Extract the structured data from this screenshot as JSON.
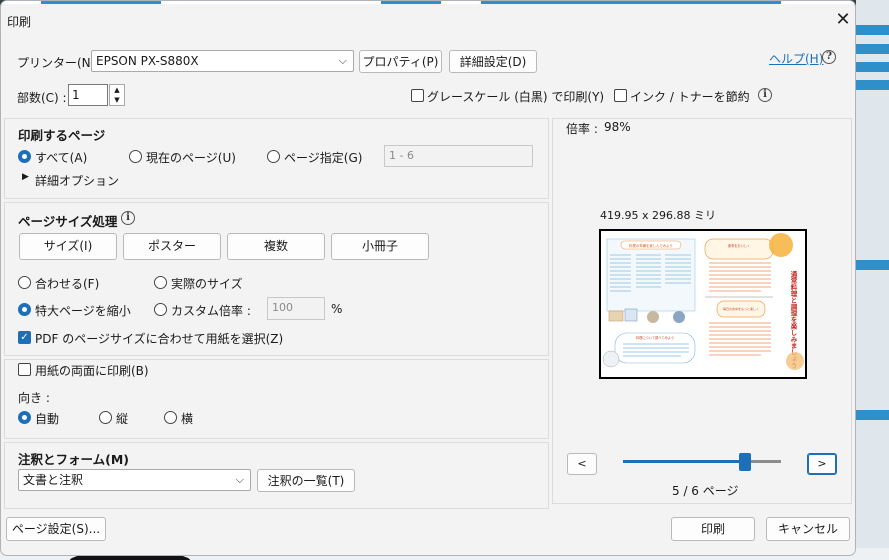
{
  "title": "印刷",
  "printer": {
    "label": "プリンター(N) :",
    "selected": "EPSON PX-S880X",
    "properties_button": "プロパティ(P)",
    "advanced_button": "詳細設定(D)",
    "help_link": "ヘルプ(H)"
  },
  "copies": {
    "label": "部数(C) :",
    "value": "1"
  },
  "options": {
    "grayscale": "グレースケール (白黒) で印刷(Y)",
    "save_ink": "インク / トナーを節約"
  },
  "pages_to_print": {
    "heading": "印刷するページ",
    "all": "すべて(A)",
    "current": "現在のページ(U)",
    "range": "ページ指定(G)",
    "range_placeholder": "1 - 6",
    "more_options": "詳細オプション"
  },
  "page_sizing": {
    "heading": "ページサイズ処理",
    "tabs": [
      "サイズ(I)",
      "ポスター",
      "複数",
      "小冊子"
    ],
    "fit": "合わせる(F)",
    "actual_size": "実際のサイズ",
    "shrink_oversized": "特大ページを縮小",
    "custom_scale": "カスタム倍率 :",
    "custom_scale_value": "100",
    "percent": "%",
    "choose_paper_by_pdf": "PDF のページサイズに合わせて用紙を選択(Z)"
  },
  "duplex": {
    "label": "用紙の両面に印刷(B)"
  },
  "orientation": {
    "label": "向き :",
    "auto": "自動",
    "portrait": "縦",
    "landscape": "横"
  },
  "comments_forms": {
    "heading": "注釈とフォーム(M)",
    "selected": "文書と注釈",
    "summarize_button": "注釈の一覧(T)"
  },
  "preview": {
    "scale_label": "倍率 :",
    "scale_value": "98%",
    "size_text": "419.95 x 296.88 ミリ",
    "page_indicator": "5 / 6 ページ",
    "prev": "<",
    "next": ">",
    "page_current": 5,
    "page_total": 6,
    "preview_texts": {
      "vertical_title": "通常料理と調理を楽しみましょう",
      "box1": "料理の準備を楽しんでみよう",
      "box2": "料理について調べてみよう",
      "box3": "食事をおいしく",
      "box4": "毎日の食卓をもっと楽しく"
    }
  },
  "footer": {
    "page_setup": "ページ設定(S)...",
    "print": "印刷",
    "cancel": "キャンセル"
  },
  "colors": {
    "accent": "#1c6fb8",
    "dialog_bg": "#f3f3f3"
  },
  "icons": [
    "close-icon",
    "chevron-down-icon",
    "help-icon",
    "info-icon",
    "triangle-right-icon"
  ]
}
